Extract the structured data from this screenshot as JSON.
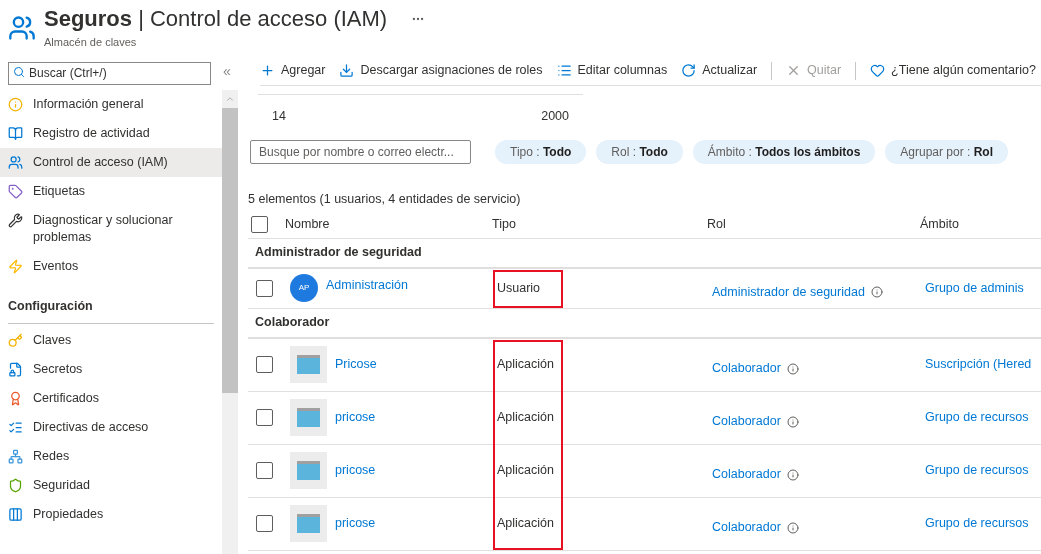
{
  "header": {
    "title": "**Seguros** | Control de acceso (IAM)",
    "subtitle": "Almacén de claves"
  },
  "sidebar": {
    "search_placeholder": "Buscar (Ctrl+/)",
    "collapse": "«",
    "items": [
      {
        "kind": "item",
        "label": "Información general",
        "selected": false
      },
      {
        "kind": "item",
        "label": "Registro de actividad",
        "selected": false
      },
      {
        "kind": "item",
        "label": "Control de acceso (IAM)",
        "selected": true
      },
      {
        "kind": "item",
        "label": "Etiquetas",
        "selected": false
      },
      {
        "kind": "item",
        "label": "Diagnosticar y solucionar problemas",
        "selected": false
      },
      {
        "kind": "item",
        "label": "Eventos",
        "selected": false
      },
      {
        "kind": "heading",
        "label": "Configuración"
      },
      {
        "kind": "item",
        "label": "Claves",
        "selected": false
      },
      {
        "kind": "item",
        "label": "Secretos",
        "selected": false
      },
      {
        "kind": "item",
        "label": "Certificados",
        "selected": false
      },
      {
        "kind": "item",
        "label": "Directivas de acceso",
        "selected": false
      },
      {
        "kind": "item",
        "label": "Redes",
        "selected": false
      },
      {
        "kind": "item",
        "label": "Seguridad",
        "selected": false
      },
      {
        "kind": "item",
        "label": "Propiedades",
        "selected": false
      }
    ]
  },
  "toolbar": [
    {
      "kind": "button",
      "label": "Agregar",
      "disabled": false
    },
    {
      "kind": "button",
      "label": "Descargar asignaciones de roles",
      "disabled": false
    },
    {
      "kind": "button",
      "label": "Editar columnas",
      "disabled": false
    },
    {
      "kind": "button",
      "label": "Actualizar",
      "disabled": false
    },
    {
      "kind": "separator"
    },
    {
      "kind": "button",
      "label": "Quitar",
      "disabled": true
    },
    {
      "kind": "separator"
    },
    {
      "kind": "button",
      "label": "¿Tiene algún comentario?",
      "disabled": false
    }
  ],
  "summary": [
    "14",
    "2000"
  ],
  "search": {
    "placeholder": "Busque por nombre o correo electr..."
  },
  "filters": [
    {
      "label": "Tipo :",
      "value": "Todo"
    },
    {
      "label": "Rol :",
      "value": "Todo"
    },
    {
      "label": "Ámbito :",
      "value": "Todos los ámbitos"
    },
    {
      "label": "Agrupar por :",
      "value": "Rol"
    }
  ],
  "table": {
    "count": "5 elementos (1 usuarios, 4 entidades de servicio)",
    "all_checked": false,
    "columns": [
      "Nombre",
      "Tipo",
      "Rol",
      "Ámbito"
    ],
    "groups": [
      {
        "name": "Administrador de seguridad",
        "highlighted": true,
        "rows": [
          {
            "kind": "user",
            "initials": "AP",
            "name": "Administración",
            "type": "Usuario",
            "role": "Administrador de seguridad",
            "scope": "Grupo de adminis",
            "checked": false
          }
        ]
      },
      {
        "name": "Colaborador",
        "highlighted": true,
        "rows": [
          {
            "kind": "app",
            "name": "Pricose",
            "type": "Aplicación",
            "role": "Colaborador",
            "scope": "Suscripción (Hered",
            "checked": false
          },
          {
            "kind": "app",
            "name": "pricose",
            "type": "Aplicación",
            "role": "Colaborador",
            "scope": "Grupo de recursos",
            "checked": false
          },
          {
            "kind": "app",
            "name": "pricose",
            "type": "Aplicación",
            "role": "Colaborador",
            "scope": "Grupo de recursos",
            "checked": false
          },
          {
            "kind": "app",
            "name": "pricose",
            "type": "Aplicación",
            "role": "Colaborador",
            "scope": "Grupo de recursos",
            "checked": false
          }
        ]
      }
    ]
  }
}
